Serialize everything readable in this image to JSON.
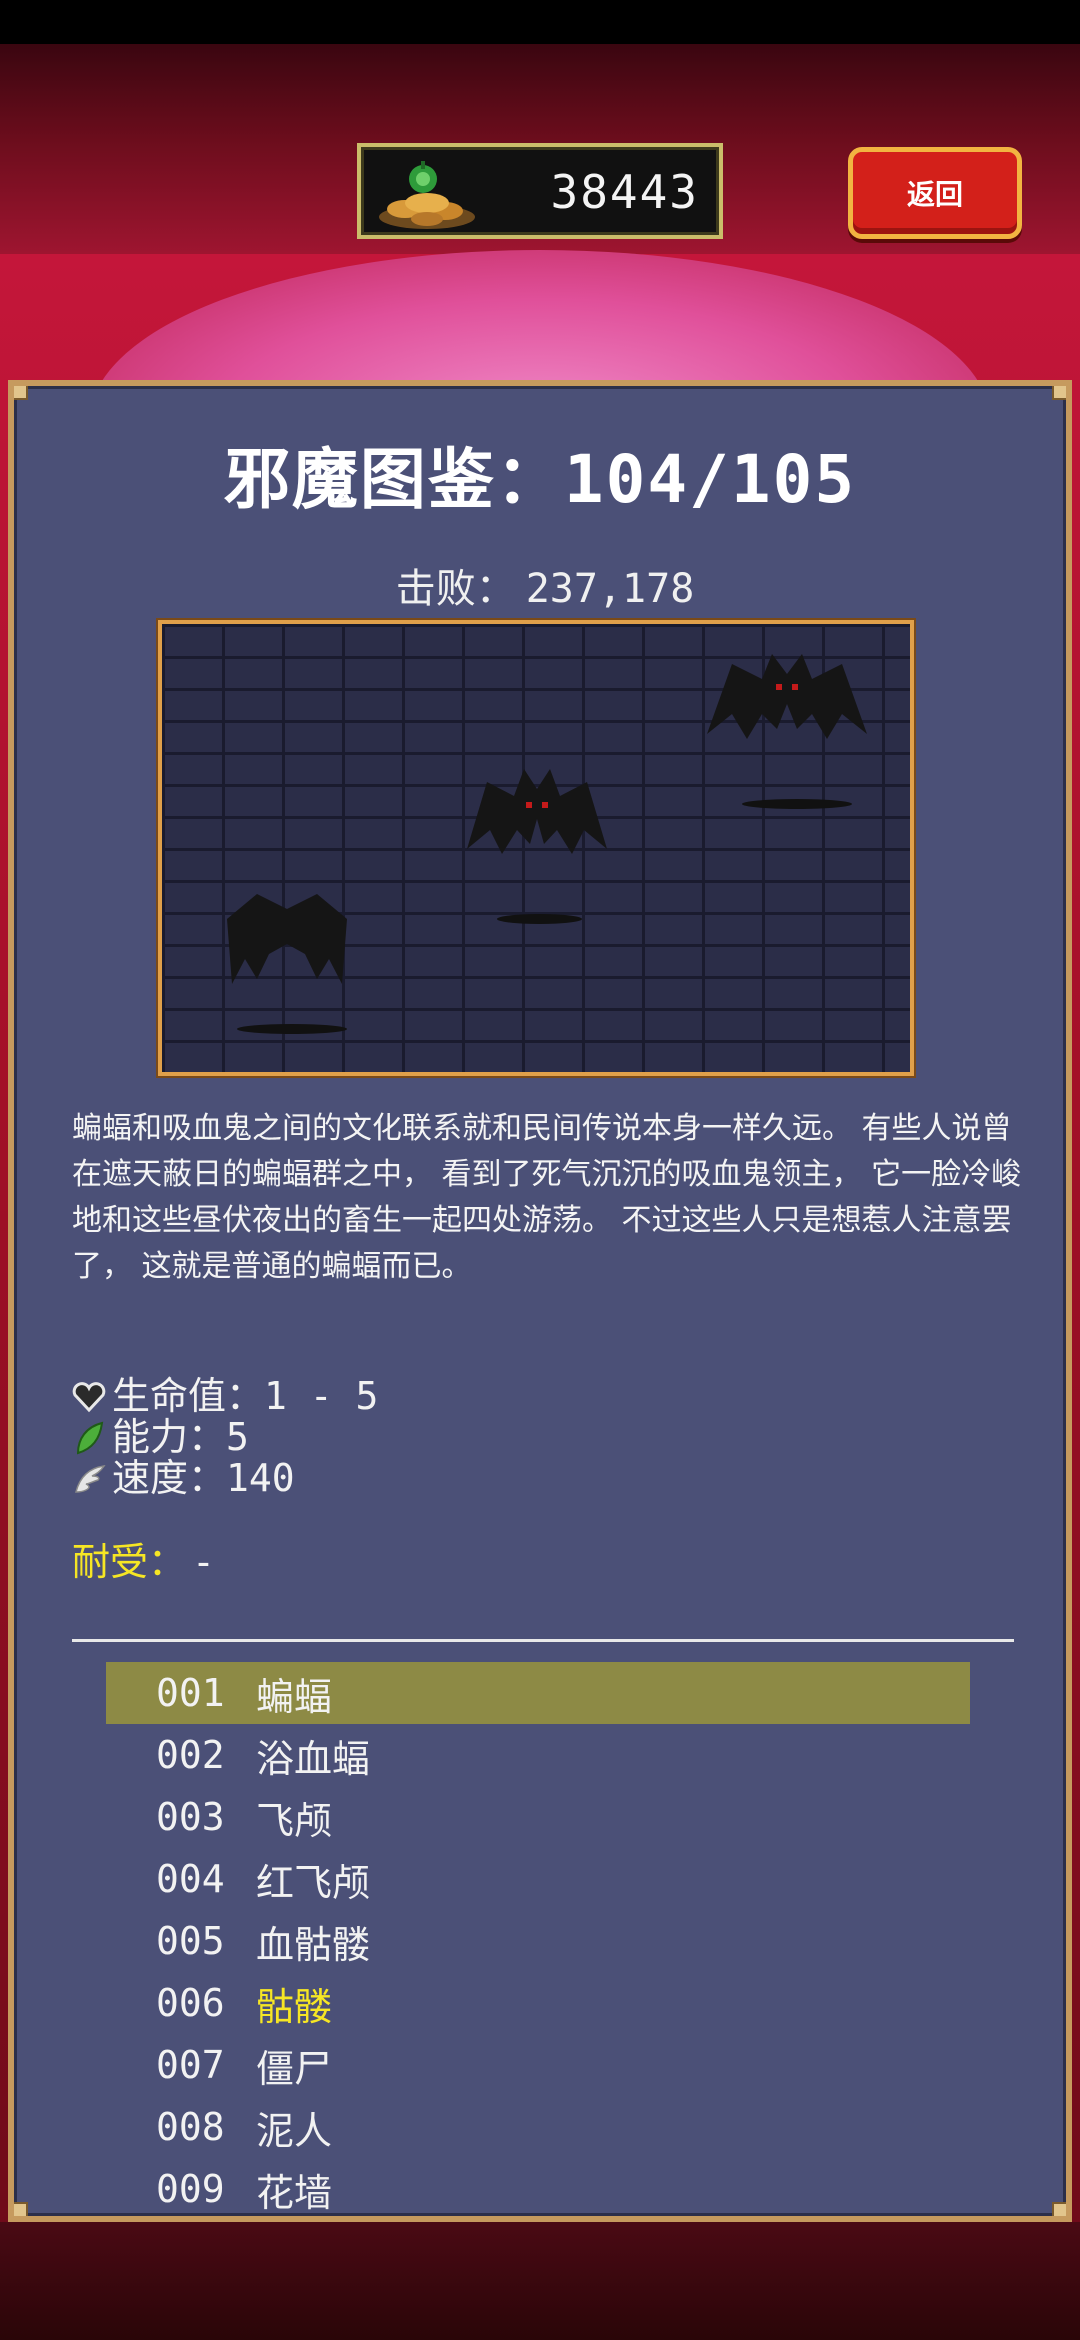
{
  "hud": {
    "gold": "38443",
    "back_label": "返回"
  },
  "bestiary": {
    "title": "邪魔图鉴：104/105",
    "kills_label": "击败：",
    "kills_value": "237,178",
    "description": "蝙蝠和吸血鬼之间的文化联系就和民间传说本身一样久远。 有些人说曾在遮天蔽日的蝙蝠群之中， 看到了死气沉沉的吸血鬼领主， 它一脸冷峻地和这些昼伏夜出的畜生一起四处游荡。 不过这些人只是想惹人注意罢了， 这就是普通的蝙蝠而已。",
    "stats": {
      "hp_label": "生命值：1 - 5",
      "power_label": "能力：5",
      "speed_label": "速度：140"
    },
    "resist_label": "耐受：",
    "resist_value": "-",
    "list": [
      {
        "num": "001",
        "name": "蝙蝠"
      },
      {
        "num": "002",
        "name": "浴血蝠"
      },
      {
        "num": "003",
        "name": "飞颅"
      },
      {
        "num": "004",
        "name": "红飞颅"
      },
      {
        "num": "005",
        "name": "血骷髅"
      },
      {
        "num": "006",
        "name": "骷髅"
      },
      {
        "num": "007",
        "name": "僵尸"
      },
      {
        "num": "008",
        "name": "泥人"
      },
      {
        "num": "009",
        "name": "花墙"
      }
    ]
  },
  "icons": {
    "heart": "heart-icon",
    "leaf": "leaf-icon",
    "wing": "wing-icon",
    "coins": "coin-pile-icon"
  },
  "colors": {
    "panel": "#4b5077",
    "frame": "#c69a5e",
    "selected_row": "#8d8a45",
    "highlight_text": "#f6e624",
    "back_button": "#d3201a"
  }
}
